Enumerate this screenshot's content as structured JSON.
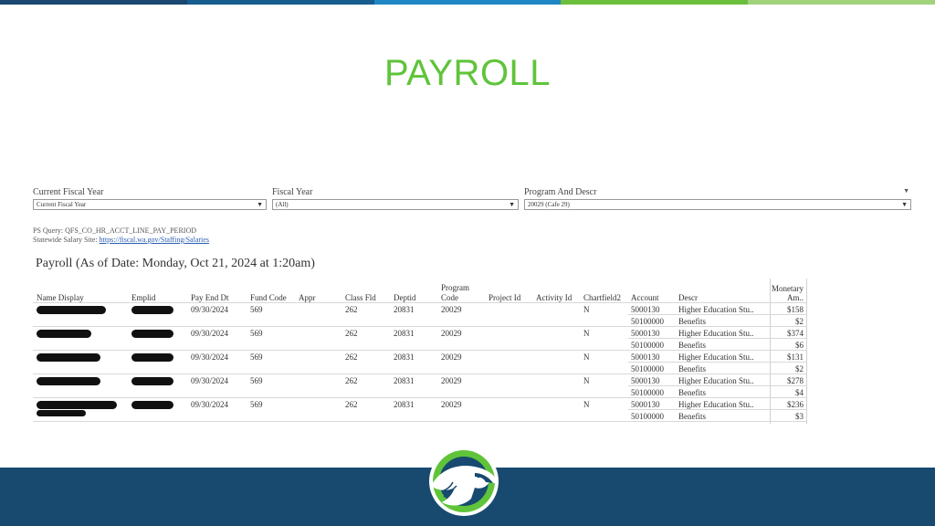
{
  "top_bar_colors": [
    "#1a4870",
    "#175c8e",
    "#1f87c4",
    "#6bbf3c",
    "#a2d27b"
  ],
  "brand_green": "#5fc43a",
  "footer_color": "#184a70",
  "slide_title": "PAYROLL",
  "filters": [
    {
      "label": "Current Fiscal Year",
      "value": "Current Fiscal Year"
    },
    {
      "label": "Fiscal Year",
      "value": "(All)"
    },
    {
      "label": "Program And Descr",
      "value": "20029 (Cafe 29)"
    }
  ],
  "meta": {
    "ps_query": "PS Query: QFS_CO_HR_ACCT_LINE_PAY_PERIOD",
    "salary_site_label": "Statewide Salary Site:",
    "salary_site_link": "https://fiscal.wa.gov/Staffing/Salaries"
  },
  "payroll_heading": "Payroll (As of Date: Monday, Oct 21, 2024 at 1:20am)",
  "table": {
    "headers": {
      "name_display": "Name Display",
      "emplid": "Emplid",
      "pay_end_dt": "Pay End Dt",
      "fund_code": "Fund Code",
      "appr": "Appr",
      "class_fld": "Class Fld",
      "deptid": "Deptid",
      "program_code_1": "Program",
      "program_code_2": "Code",
      "project_id": "Project Id",
      "activity_id": "Activity Id",
      "chartfield2": "Chartfield2",
      "account": "Account",
      "descr": "Descr",
      "monetary_1": "Monetary",
      "monetary_2": "Am.."
    },
    "rows": [
      {
        "pay_end_dt": "09/30/2024",
        "fund_code": "569",
        "class_fld": "262",
        "deptid": "20831",
        "program_code": "20029",
        "chartfield2": "N",
        "lines": [
          {
            "account": "5000130",
            "descr": "Higher Education Stu..",
            "amount": "$158"
          },
          {
            "account": "50100000",
            "descr": "Benefits",
            "amount": "$2"
          }
        ]
      },
      {
        "pay_end_dt": "09/30/2024",
        "fund_code": "569",
        "class_fld": "262",
        "deptid": "20831",
        "program_code": "20029",
        "chartfield2": "N",
        "lines": [
          {
            "account": "5000130",
            "descr": "Higher Education Stu..",
            "amount": "$374"
          },
          {
            "account": "50100000",
            "descr": "Benefits",
            "amount": "$6"
          }
        ]
      },
      {
        "pay_end_dt": "09/30/2024",
        "fund_code": "569",
        "class_fld": "262",
        "deptid": "20831",
        "program_code": "20029",
        "chartfield2": "N",
        "lines": [
          {
            "account": "5000130",
            "descr": "Higher Education Stu..",
            "amount": "$131"
          },
          {
            "account": "50100000",
            "descr": "Benefits",
            "amount": "$2"
          }
        ]
      },
      {
        "pay_end_dt": "09/30/2024",
        "fund_code": "569",
        "class_fld": "262",
        "deptid": "20831",
        "program_code": "20029",
        "chartfield2": "N",
        "lines": [
          {
            "account": "5000130",
            "descr": "Higher Education Stu..",
            "amount": "$278"
          },
          {
            "account": "50100000",
            "descr": "Benefits",
            "amount": "$4"
          }
        ]
      },
      {
        "pay_end_dt": "09/30/2024",
        "fund_code": "569",
        "class_fld": "262",
        "deptid": "20831",
        "program_code": "20029",
        "chartfield2": "N",
        "lines": [
          {
            "account": "5000130",
            "descr": "Higher Education Stu..",
            "amount": "$236"
          },
          {
            "account": "50100000",
            "descr": "Benefits",
            "amount": "$3"
          }
        ]
      }
    ]
  },
  "icons": {
    "dropdown": "chevron-down-icon",
    "logo": "eagle-logo-icon"
  }
}
